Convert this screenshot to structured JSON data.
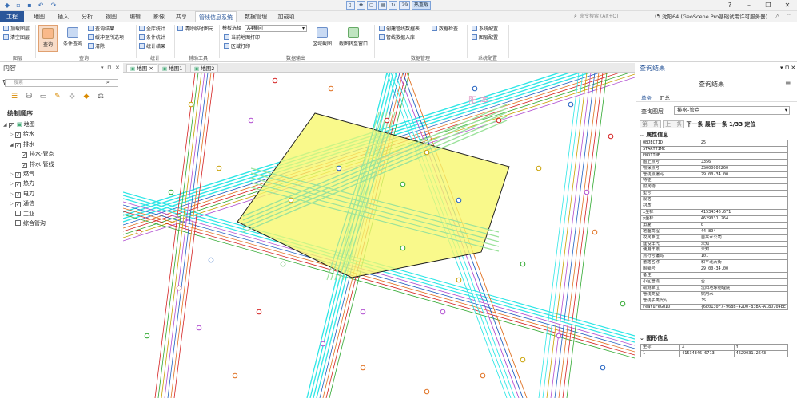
{
  "tabs": [
    {
      "label": "工程"
    },
    {
      "label": "地图"
    },
    {
      "label": "插入"
    },
    {
      "label": "分析"
    },
    {
      "label": "视图"
    },
    {
      "label": "编辑"
    },
    {
      "label": "影像"
    },
    {
      "label": "共享"
    },
    {
      "label": "管线信息系统"
    },
    {
      "label": "数据管理"
    },
    {
      "label": "加载项"
    }
  ],
  "title_tools": {
    "count": "29",
    "hot": "热重载"
  },
  "search": {
    "placeholder": "命令搜索 (Alt+Q)"
  },
  "user": {
    "label": "沈阳64 (GeoScene Pro基础试用许可服务器)"
  },
  "ribbon": {
    "layer_group": {
      "title": "图层",
      "items": [
        "加载图层",
        "清空图层"
      ]
    },
    "query_group": {
      "title": "查询",
      "big1": "查询",
      "big2": "条件查询",
      "items": [
        "查询结果",
        "缓冲查询",
        "清除"
      ],
      "item_extra": "缓冲至所选项"
    },
    "stat_group": {
      "title": "统计",
      "items": [
        "全库统计",
        "条件统计",
        "统计结果"
      ]
    },
    "aux_group": {
      "title": "辅助工具",
      "items": [
        "清除临时图元"
      ]
    },
    "output_group": {
      "title": "数据输出",
      "template_label": "模板选择",
      "template_value": "A4横向",
      "items": [
        "当前地图打印",
        "区域打印"
      ],
      "big1": "区域截图",
      "big2": "截图转至窗口"
    },
    "manage_group": {
      "title": "数据管理",
      "items": [
        "创建管线数据表",
        "管线数据入库"
      ],
      "check": "数据检查"
    },
    "sys_group": {
      "title": "系统配置",
      "items": [
        "系统配置",
        "图层配置"
      ]
    }
  },
  "left_pane": {
    "title": "内容",
    "search_placeholder": "搜索",
    "draw_order": "绘制顺序",
    "tree": [
      {
        "label": "地图",
        "checked": true,
        "level": 0
      },
      {
        "label": "给水",
        "checked": true,
        "level": 1
      },
      {
        "label": "排水",
        "checked": true,
        "level": 1
      },
      {
        "label": "排水-管点",
        "checked": true,
        "level": 2
      },
      {
        "label": "排水-管线",
        "checked": true,
        "level": 2
      },
      {
        "label": "燃气",
        "checked": true,
        "level": 1
      },
      {
        "label": "热力",
        "checked": true,
        "level": 1
      },
      {
        "label": "电力",
        "checked": true,
        "level": 1
      },
      {
        "label": "通信",
        "checked": true,
        "level": 1
      },
      {
        "label": "工业",
        "checked": false,
        "level": 1
      },
      {
        "label": "综合管沟",
        "checked": false,
        "level": 1
      }
    ]
  },
  "map_tabs": [
    {
      "label": "地图"
    },
    {
      "label": "地图1"
    },
    {
      "label": "地图2"
    }
  ],
  "map": {
    "watermark": "阳 本"
  },
  "right_pane": {
    "title": "查询结果",
    "subtitle": "查询结果",
    "tabs": [
      {
        "label": "单条"
      },
      {
        "label": "汇总"
      }
    ],
    "layer_label": "查询图层",
    "layer_value": "排水-管点",
    "nav_first": "第一条",
    "nav_prev": "上一条",
    "nav_next": "下一条",
    "nav_last": "最后一条",
    "nav_count": "1/33",
    "nav_locate": "定位",
    "attr_section": "属性信息",
    "attributes": [
      [
        "OBJECTID",
        "25"
      ],
      [
        "STARTTIME",
        ""
      ],
      [
        "ENDTIME",
        ""
      ],
      [
        "图上点号",
        "J356"
      ],
      [
        "物探点号",
        "JS000002260"
      ],
      [
        "管线点编码",
        "29.00-34.00"
      ],
      [
        "特征",
        ""
      ],
      [
        "附属物",
        ""
      ],
      [
        "型号",
        ""
      ],
      [
        "规格",
        ""
      ],
      [
        "材质",
        ""
      ],
      [
        "x坐标",
        "41534346.671"
      ],
      [
        "y坐标",
        "4629031.264"
      ],
      [
        "角度",
        "0"
      ],
      [
        "地面高程",
        "44.894"
      ],
      [
        "权属单位",
        "自来水公司"
      ],
      [
        "建设年代",
        "未知"
      ],
      [
        "使用年限",
        "未知"
      ],
      [
        "点符号编码",
        "101"
      ],
      [
        "道路名称",
        "和平北大街"
      ],
      [
        "图幅号",
        "29.00-34.00"
      ],
      [
        "备注",
        ""
      ],
      [
        "小区管线",
        "否"
      ],
      [
        "勘测单位",
        "沈阳地球物理院"
      ],
      [
        "管线类型",
        "饮用水"
      ],
      [
        "管线子类代码",
        "JS"
      ],
      [
        "FeatureGUID",
        "{6E0130F7-968B-42D0-83BA-A18D704EE"
      ]
    ],
    "geo_section": "图形信息",
    "geometry": {
      "headers": [
        "坐标",
        "X",
        "Y"
      ],
      "rows": [
        [
          "1",
          "41534346.6713",
          "4629031.2643"
        ]
      ]
    }
  },
  "colors": {
    "accent": "#2b579a",
    "cyan": "#2ee6e6",
    "polygon": "#f7f76a",
    "red": "#d42020",
    "green": "#2fa82f"
  }
}
